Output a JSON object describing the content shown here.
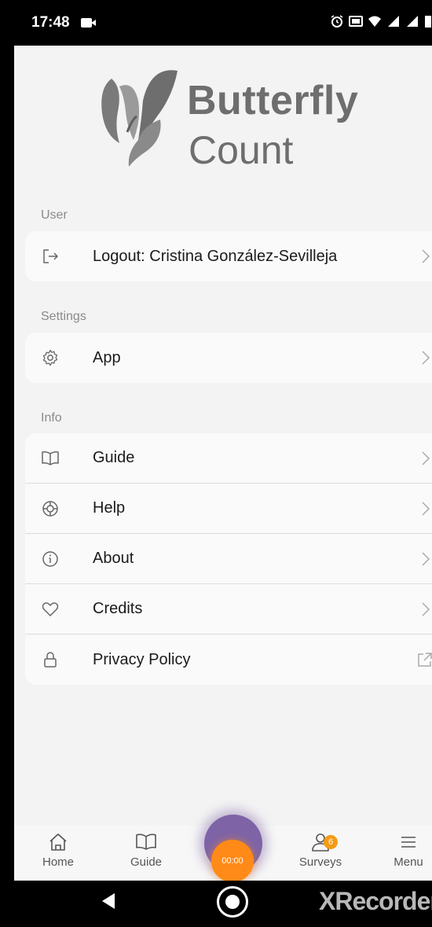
{
  "status_bar": {
    "time": "17:48"
  },
  "logo": {
    "word1": "Butterfly",
    "word2": "Count"
  },
  "sections": {
    "user": {
      "label": "User",
      "items": [
        {
          "label": "Logout: Cristina González-Sevilleja",
          "icon": "logout-icon"
        }
      ]
    },
    "settings": {
      "label": "Settings",
      "items": [
        {
          "label": "App",
          "icon": "gear-icon"
        }
      ]
    },
    "info": {
      "label": "Info",
      "items": [
        {
          "label": "Guide",
          "icon": "book-icon"
        },
        {
          "label": "Help",
          "icon": "lifebuoy-icon"
        },
        {
          "label": "About",
          "icon": "info-icon"
        },
        {
          "label": "Credits",
          "icon": "heart-icon"
        },
        {
          "label": "Privacy Policy",
          "icon": "lock-icon"
        }
      ]
    }
  },
  "bottom_nav": {
    "items": [
      {
        "label": "Home",
        "icon": "home-icon"
      },
      {
        "label": "Guide",
        "icon": "book-icon"
      },
      {
        "label": "Surveys",
        "icon": "person-icon",
        "badge": "6"
      },
      {
        "label": "Menu",
        "icon": "menu-icon"
      }
    ],
    "timer": "00:00"
  },
  "system_bar": {
    "watermark": "XRecorder"
  },
  "colors": {
    "accent": "#ff8a18",
    "fab_halo": "#7e64a6",
    "badge": "#f59b16"
  }
}
